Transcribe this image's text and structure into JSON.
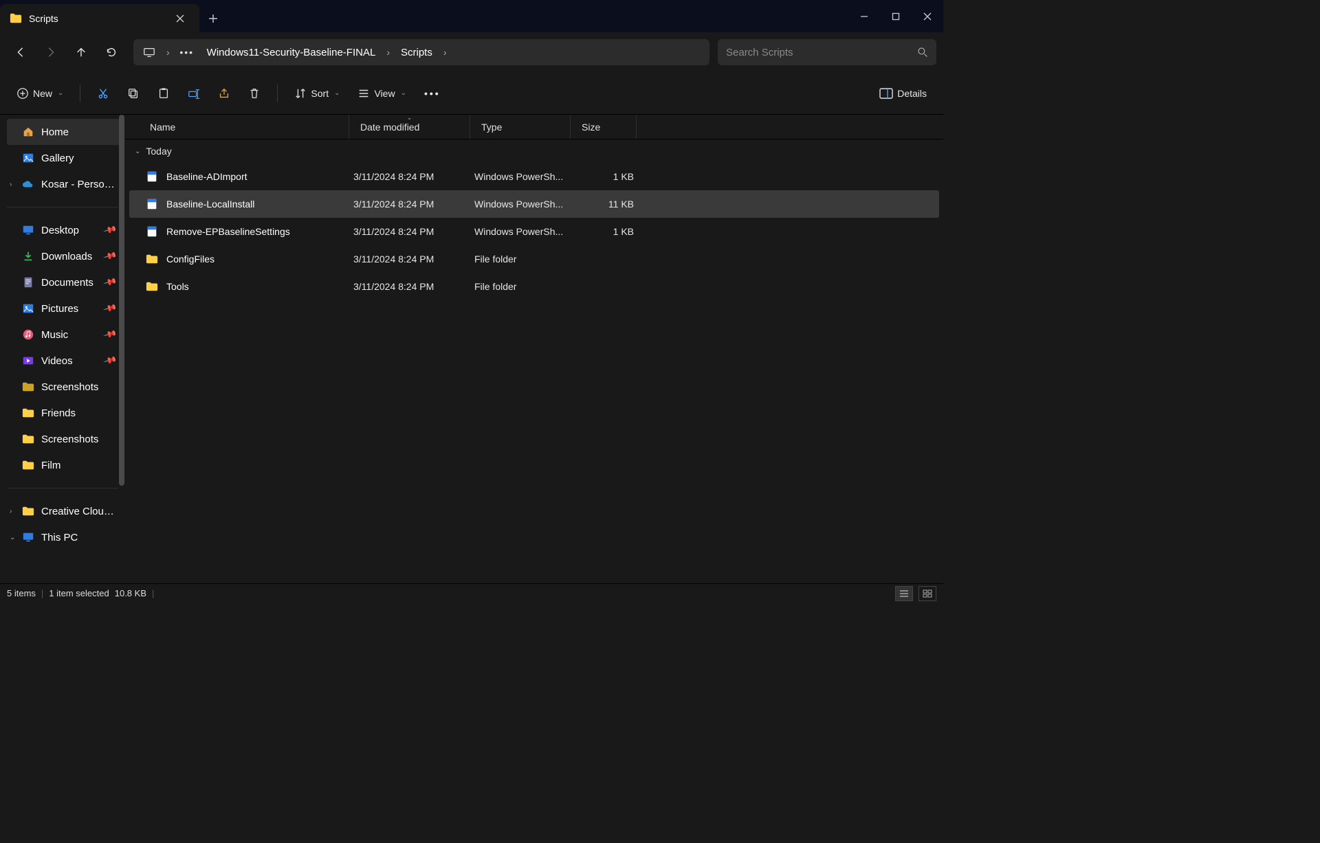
{
  "tab": {
    "title": "Scripts"
  },
  "breadcrumb": {
    "seg1": "Windows11-Security-Baseline-FINAL",
    "seg2": "Scripts"
  },
  "search": {
    "placeholder": "Search Scripts"
  },
  "cmdbar": {
    "new": "New",
    "sort": "Sort",
    "view": "View",
    "details": "Details"
  },
  "columns": {
    "name": "Name",
    "date": "Date modified",
    "type": "Type",
    "size": "Size"
  },
  "group": {
    "today": "Today"
  },
  "files": [
    {
      "name": "Baseline-ADImport",
      "date": "3/11/2024 8:24 PM",
      "type": "Windows PowerSh...",
      "size": "1 KB",
      "kind": "ps"
    },
    {
      "name": "Baseline-LocalInstall",
      "date": "3/11/2024 8:24 PM",
      "type": "Windows PowerSh...",
      "size": "11 KB",
      "kind": "ps",
      "selected": true
    },
    {
      "name": "Remove-EPBaselineSettings",
      "date": "3/11/2024 8:24 PM",
      "type": "Windows PowerSh...",
      "size": "1 KB",
      "kind": "ps"
    },
    {
      "name": "ConfigFiles",
      "date": "3/11/2024 8:24 PM",
      "type": "File folder",
      "size": "",
      "kind": "folder"
    },
    {
      "name": "Tools",
      "date": "3/11/2024 8:24 PM",
      "type": "File folder",
      "size": "",
      "kind": "folder"
    }
  ],
  "sidebar": {
    "home": "Home",
    "gallery": "Gallery",
    "onedrive": "Kosar - Personal",
    "desktop": "Desktop",
    "downloads": "Downloads",
    "documents": "Documents",
    "pictures": "Pictures",
    "music": "Music",
    "videos": "Videos",
    "screenshots": "Screenshots",
    "friends": "Friends",
    "screenshots2": "Screenshots",
    "film": "Film",
    "ccf": "Creative Cloud F",
    "thispc": "This PC"
  },
  "status": {
    "count": "5 items",
    "selected": "1 item selected",
    "size": "10.8 KB"
  }
}
